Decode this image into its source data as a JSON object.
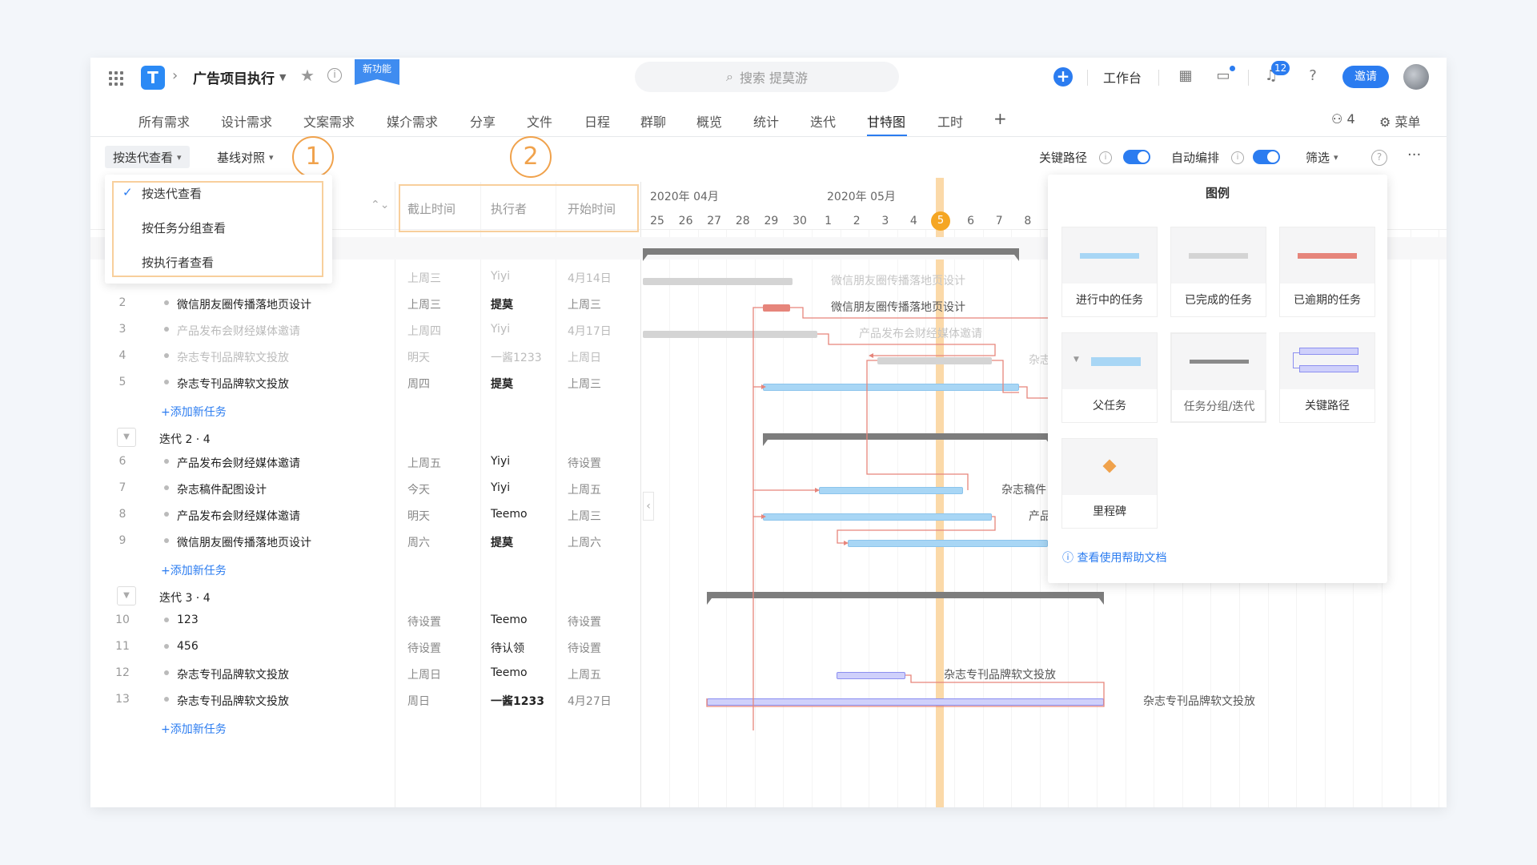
{
  "topbar": {
    "project": "广告项目执行",
    "new_tag": "新功能",
    "search_placeholder": "搜索 提莫游",
    "workbench": "工作台",
    "notif_count": "12",
    "invite": "邀请"
  },
  "nav": {
    "tabs": [
      "所有需求",
      "设计需求",
      "文案需求",
      "媒介需求",
      "分享",
      "文件",
      "日程",
      "群聊",
      "概览",
      "统计",
      "迭代",
      "甘特图",
      "工时"
    ],
    "active": "甘特图",
    "members": "4",
    "menu": "菜单"
  },
  "toolbar": {
    "view_by": "按迭代查看",
    "baseline": "基线对照",
    "callout_1": "1",
    "callout_2": "2",
    "critical_path": "关键路径",
    "auto_schedule": "自动编排",
    "filter": "筛选"
  },
  "dropdown": {
    "items": [
      "按迭代查看",
      "按任务分组查看",
      "按执行者查看"
    ]
  },
  "columns": {
    "deadline": "截止时间",
    "assignee": "执行者",
    "start": "开始时间"
  },
  "timeline": {
    "month1": "2020年 04月",
    "month2": "2020年 05月",
    "days": [
      "25",
      "26",
      "27",
      "28",
      "29",
      "30",
      "1",
      "2",
      "3",
      "4",
      "5",
      "6",
      "7",
      "8"
    ],
    "today": "5"
  },
  "tasks": [
    {
      "num": "",
      "name": "",
      "deadline": "上周三",
      "assignee": "Yiyi",
      "start": "4月14日",
      "muted": true
    },
    {
      "num": "2",
      "name": "微信朋友圈传播落地页设计",
      "deadline": "上周三",
      "assignee": "提莫",
      "start": "上周三",
      "muted": false
    },
    {
      "num": "3",
      "name": "产品发布会财经媒体邀请",
      "deadline": "上周四",
      "assignee": "Yiyi",
      "start": "4月17日",
      "muted": true
    },
    {
      "num": "4",
      "name": "杂志专刊品牌软文投放",
      "deadline": "明天",
      "assignee": "一酱1233",
      "start": "上周日",
      "muted": true
    },
    {
      "num": "5",
      "name": "杂志专刊品牌软文投放",
      "deadline": "周四",
      "assignee": "提莫",
      "start": "上周三",
      "muted": false
    },
    {
      "num": "6",
      "name": "产品发布会财经媒体邀请",
      "deadline": "上周五",
      "assignee": "Yiyi",
      "start": "待设置",
      "muted": false
    },
    {
      "num": "7",
      "name": "杂志稿件配图设计",
      "deadline": "今天",
      "assignee": "Yiyi",
      "start": "上周五",
      "muted": false
    },
    {
      "num": "8",
      "name": "产品发布会财经媒体邀请",
      "deadline": "明天",
      "assignee": "Teemo",
      "start": "上周三",
      "muted": false
    },
    {
      "num": "9",
      "name": "微信朋友圈传播落地页设计",
      "deadline": "周六",
      "assignee": "提莫",
      "start": "上周六",
      "muted": false
    },
    {
      "num": "10",
      "name": "123",
      "deadline": "待设置",
      "assignee": "Teemo",
      "start": "待设置",
      "muted": false
    },
    {
      "num": "11",
      "name": "456",
      "deadline": "待设置",
      "assignee": "待认领",
      "start": "待设置",
      "muted": false
    },
    {
      "num": "12",
      "name": "杂志专刊品牌软文投放",
      "deadline": "上周日",
      "assignee": "Teemo",
      "start": "上周五",
      "muted": false
    },
    {
      "num": "13",
      "name": "杂志专刊品牌软文投放",
      "deadline": "周日",
      "assignee": "一酱1233",
      "start": "4月27日",
      "muted": false
    }
  ],
  "groups": [
    "迭代 2 · 4",
    "迭代 3 · 4"
  ],
  "add_task": "+添加新任务",
  "bar_labels": {
    "r1": "微信朋友圈传播落地页设计",
    "r2": "微信朋友圈传播落地页设计",
    "r3": "产品发布会财经媒体邀请",
    "r4": "杂志",
    "r7": "杂志稿件",
    "r8": "产品",
    "r12": "杂志专刊品牌软文投放",
    "r13": "杂志专刊品牌软文投放"
  },
  "legend": {
    "title": "图例",
    "items": [
      "进行中的任务",
      "已完成的任务",
      "已逾期的任务",
      "父任务",
      "任务分组/迭代",
      "关键路径",
      "里程碑"
    ],
    "help": "查看使用帮助文档"
  },
  "colors": {
    "accent": "#2b7cf0",
    "in_progress": "#a8d6f5",
    "done": "#d4d4d4",
    "overdue": "#e6857b",
    "critical": "#8c8ff0",
    "milestone": "#f0a24c",
    "today": "#f5a623"
  }
}
